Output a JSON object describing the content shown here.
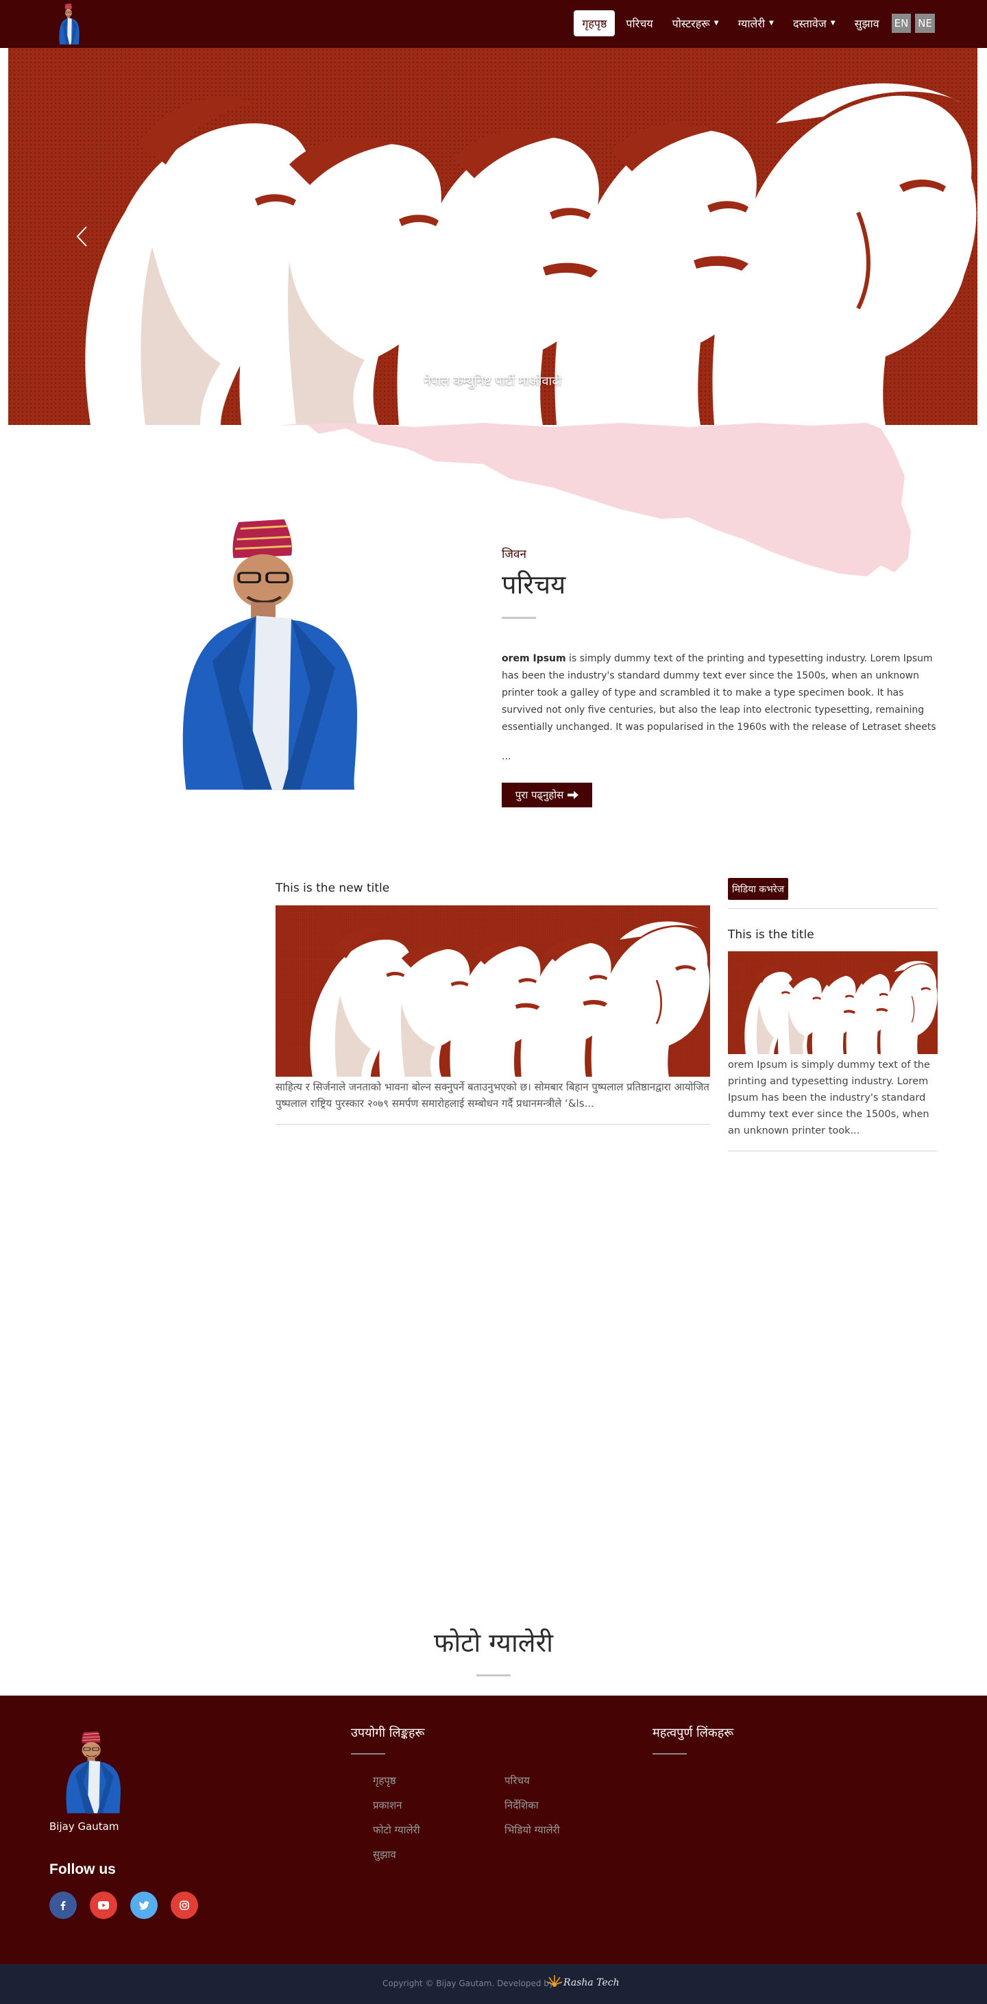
{
  "nav": {
    "items": [
      {
        "label": "गृहपृष्ठ",
        "active": true,
        "dropdown": false
      },
      {
        "label": "परिचय",
        "active": false,
        "dropdown": false
      },
      {
        "label": "पोस्टरहरू",
        "active": false,
        "dropdown": true
      },
      {
        "label": "ग्यालेरी",
        "active": false,
        "dropdown": true
      },
      {
        "label": "दस्तावेज",
        "active": false,
        "dropdown": true
      },
      {
        "label": "सुझाव",
        "active": false,
        "dropdown": false
      }
    ],
    "lang_en": "EN",
    "lang_ne": "NE"
  },
  "hero": {
    "caption": "नेपाल कम्युनिष्ट पार्टी माओवादी"
  },
  "bio": {
    "eyebrow": "जिवन",
    "title": "परिचय",
    "lead_bold": "orem Ipsum",
    "text": " is simply dummy text of the printing and typesetting industry. Lorem Ipsum has been the industry's standard dummy text ever since the 1500s, when an unknown printer took a galley of type and scrambled it to make a type specimen book. It has survived not only five centuries, but also the leap into electronic typesetting, remaining essentially unchanged. It was popularised in the 1960s with the release of Letraset sheets",
    "ellipsis": "...",
    "read_more": "पुरा पढ्नुहोस"
  },
  "news": {
    "title": "This is the new title",
    "text": "साहित्य र सिर्जनाले जनताको भावना बोल्न सक्नुपर्ने बताउनुभएको छ। सोमबार बिहान पुष्पलाल प्रतिष्ठानद्वारा आयोजित पुष्पलाल राष्ट्रिय पुरस्कार २०७९ समर्पण समारोहलाई सम्बोधन गर्दै प्रधानमन्त्रीले ‘&ls..."
  },
  "sidebar": {
    "badge": "मिडिया कभरेज",
    "title": "This is the title",
    "text": "orem Ipsum is simply dummy text of the printing and typesetting industry. Lorem Ipsum has been the industry's standard dummy text ever since the 1500s, when an unknown printer took..."
  },
  "gallery": {
    "title": "फोटो ग्यालेरी"
  },
  "footer": {
    "name": "Bijay Gautam",
    "follow": "Follow us",
    "useful_heading": "उपयोगी लिङ्कहरू",
    "important_heading": "महत्वपुर्ण लिंकहरू",
    "links": [
      "गृहपृष्ठ",
      "परिचय",
      "प्रकाशन",
      "निर्देशिका",
      "फोटो ग्यालेरी",
      "भिडियो ग्यालेरी",
      "सुझाव"
    ],
    "copyright": "Copyright © Bijay Gautam. Developed by:",
    "developer": "Rasha Tech"
  },
  "colors": {
    "brand": "#450304",
    "hero_red": "#9c2a14",
    "map_pink": "#f7d7dc",
    "bottom_bar": "#1b2236"
  },
  "icons": [
    "chevron-left-icon",
    "chevron-right-icon",
    "arrow-right-icon",
    "facebook-icon",
    "youtube-icon",
    "twitter-icon",
    "instagram-icon"
  ]
}
